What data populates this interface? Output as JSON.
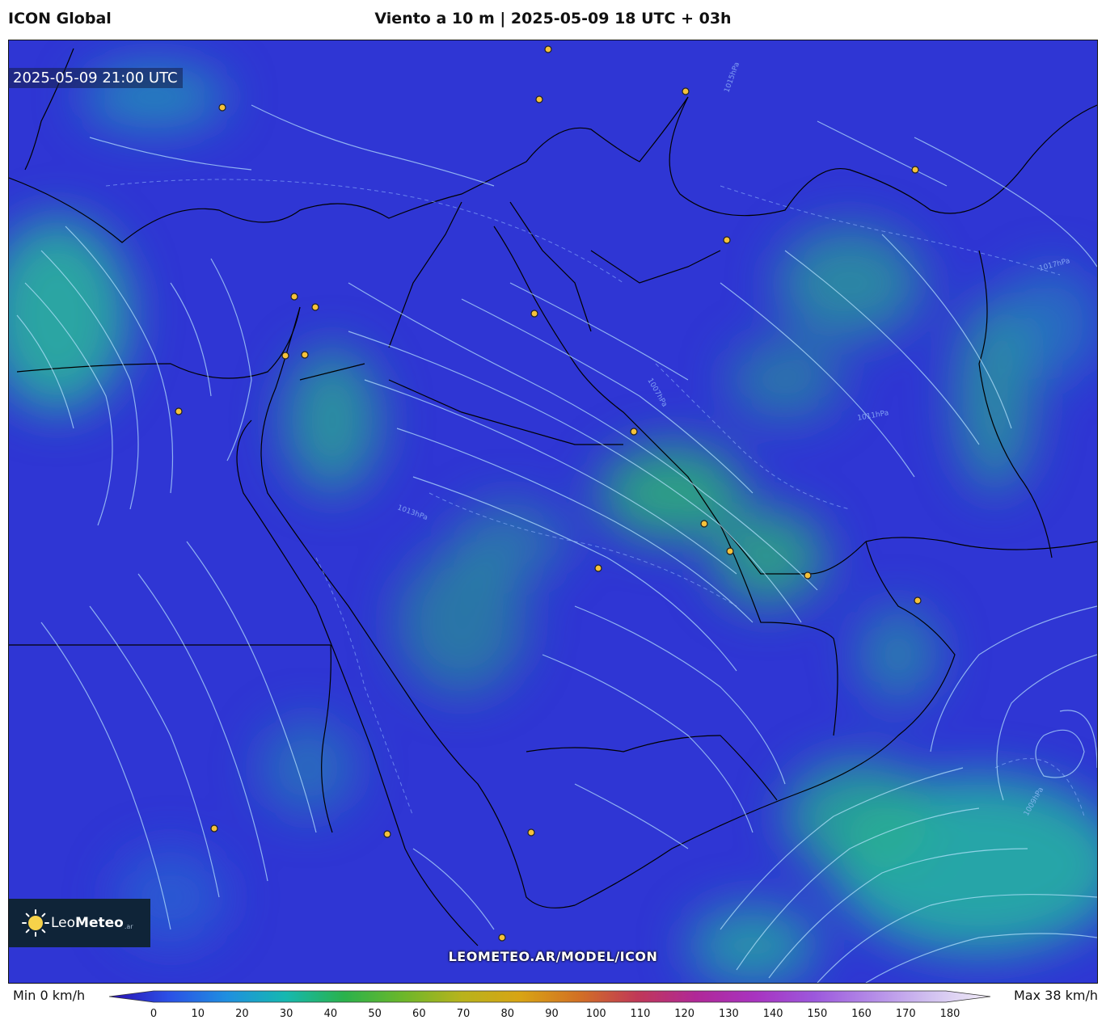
{
  "header": {
    "model": "ICON Global",
    "title": "Viento a 10 m | 2025-05-09 18 UTC + 03h"
  },
  "map": {
    "timestamp": "2025-05-09 21:00 UTC",
    "watermark": "LEOMETEO.AR/MODEL/ICON",
    "logo": {
      "brand_light": "Leo",
      "brand_bold": "Meteo",
      "suffix": ".ar",
      "icon": "sun-icon"
    },
    "isobar_labels": [
      "1015hPa",
      "1013hPa",
      "1017hPa",
      "1007hPa",
      "1009hPa",
      "1011hPa"
    ],
    "cities_marked": 21
  },
  "legend": {
    "min_label": "Min 0 km/h",
    "max_label": "Max 38 km/h",
    "ticks": [
      "0",
      "10",
      "20",
      "30",
      "40",
      "50",
      "60",
      "70",
      "80",
      "90",
      "100",
      "110",
      "120",
      "130",
      "140",
      "150",
      "160",
      "170",
      "180"
    ],
    "colors": [
      "#2a0fb0",
      "#2b4fe6",
      "#1f8fe0",
      "#16b8b0",
      "#2ab24c",
      "#6cb72a",
      "#b8b31c",
      "#d8a414",
      "#d27024",
      "#c03858",
      "#b02898",
      "#a834c0",
      "#9c58dc",
      "#b48ce8",
      "#d2c2f0",
      "#f2eef8"
    ]
  }
}
